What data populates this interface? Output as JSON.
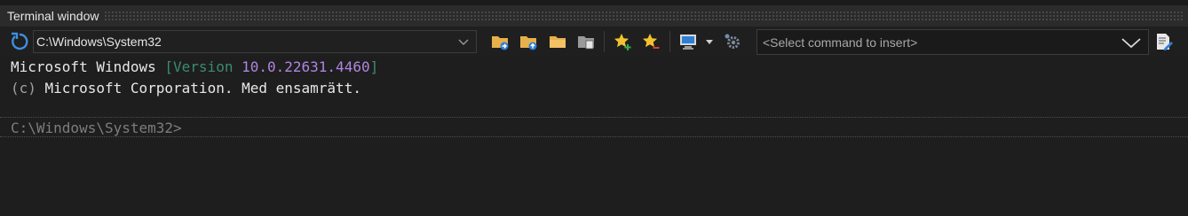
{
  "window": {
    "title": "Terminal window"
  },
  "toolbar": {
    "path_value": "C:\\Windows\\System32",
    "command_placeholder": "<Select command to insert>",
    "icons": [
      "refresh-icon",
      "chevron-down-icon",
      "folder-go-icon",
      "folder-up-icon",
      "folder-icon",
      "folder-copy-icon",
      "favorite-add-icon",
      "favorite-remove-icon",
      "monitor-icon",
      "caret-down-icon",
      "settings-gear-icon",
      "chevron-down-icon",
      "edit-script-icon"
    ]
  },
  "console": {
    "line1_prefix": "Microsoft Windows ",
    "line1_bracket_open": "[Version ",
    "line1_version": "10.0.22631.4460",
    "line1_bracket_close": "]",
    "line2_c": "(c)",
    "line2_text": " Microsoft Corporation. Med ensamrätt.",
    "prompt": "C:\\Windows\\System32>"
  },
  "colors": {
    "background": "#1e1e1e",
    "version_number": "#b084e0",
    "version_bracket": "#3c8b72",
    "folder": "#e8b04b",
    "star": "#f2c230",
    "accent_blue": "#3d8fe0"
  }
}
